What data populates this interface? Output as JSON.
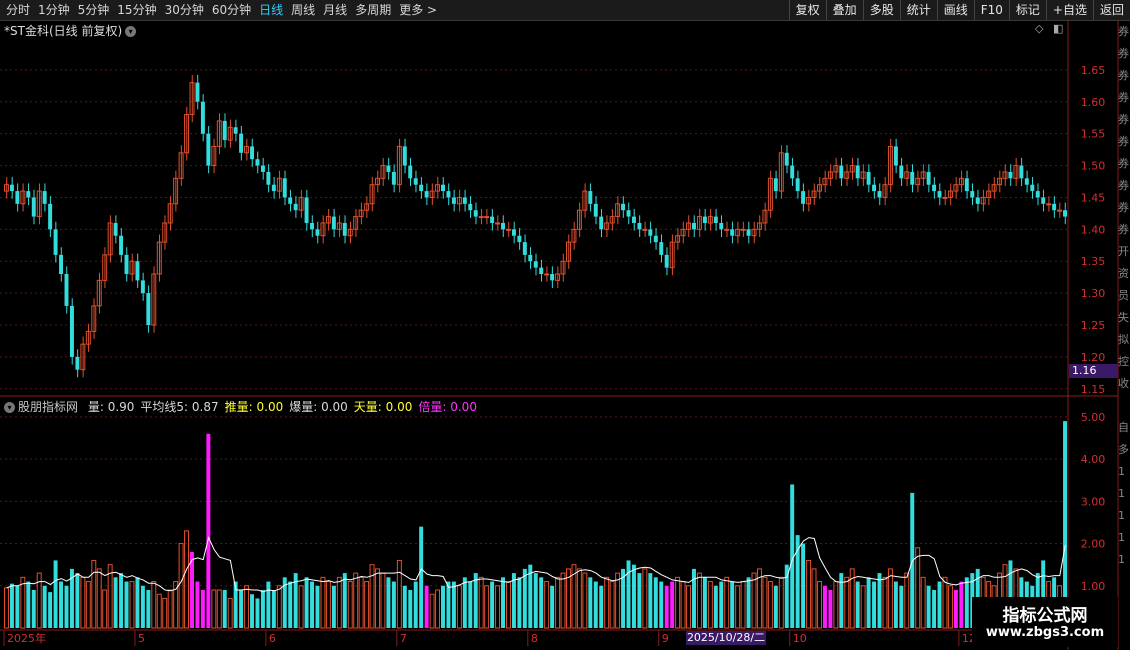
{
  "toolbar": {
    "periods": [
      {
        "label": "分时",
        "active": false
      },
      {
        "label": "1分钟",
        "active": false
      },
      {
        "label": "5分钟",
        "active": false
      },
      {
        "label": "15分钟",
        "active": false
      },
      {
        "label": "30分钟",
        "active": false
      },
      {
        "label": "60分钟",
        "active": false
      },
      {
        "label": "日线",
        "active": true
      },
      {
        "label": "周线",
        "active": false
      },
      {
        "label": "月线",
        "active": false
      },
      {
        "label": "多周期",
        "active": false
      },
      {
        "label": "更多 >",
        "active": false
      }
    ],
    "buttons": [
      "复权",
      "叠加",
      "多股",
      "统计",
      "画线",
      "F10",
      "标记",
      "+自选",
      "返回"
    ]
  },
  "main_title": "*ST金科(日线 前复权)",
  "main_title_icon": "chevron-down-icon",
  "corner_icons": [
    "diamond-icon",
    "panel-toggle-icon"
  ],
  "indicator": {
    "name": "股朋指标网",
    "fields": [
      {
        "label": "量:",
        "value": "0.90",
        "color": "#d8d8d8"
      },
      {
        "label": "平均线5:",
        "value": "0.87",
        "color": "#d8d8d8"
      },
      {
        "label": "推量:",
        "value": "0.00",
        "color": "#ffff33"
      },
      {
        "label": "爆量:",
        "value": "0.00",
        "color": "#d8d8d8"
      },
      {
        "label": "天量:",
        "value": "0.00",
        "color": "#ffff33"
      },
      {
        "label": "倍量:",
        "value": "0.00",
        "color": "#ff33ff"
      }
    ]
  },
  "current_price_tag": "1.16",
  "crosshair_date": "2025/10/28/二",
  "watermark": {
    "line1": "指标公式网",
    "line2": "www.zbgs3.com"
  },
  "right_strip_chars": [
    "券",
    "券",
    "券",
    "券",
    "券",
    "券",
    "券",
    "券",
    "券",
    "券",
    "开",
    "资",
    "员",
    "失",
    "拟",
    "控",
    "收",
    "",
    "自",
    "多",
    "1",
    "1",
    "1",
    "1",
    "1"
  ],
  "colors": {
    "up": "#e0502e",
    "down": "#33dddd",
    "special": "#ff1aff",
    "grid": "#5c1515",
    "axis_text": "#d03030",
    "ma_line": "#ffffff",
    "active_tab": "#33ccff"
  },
  "chart_data": [
    {
      "type": "candlestick",
      "title": "*ST金科(日线 前复权)",
      "y_axis_ticks": [
        "1.65",
        "1.60",
        "1.55",
        "1.50",
        "1.45",
        "1.40",
        "1.35",
        "1.30",
        "1.25",
        "1.20",
        "1.15"
      ],
      "ylim": [
        1.145,
        1.7
      ],
      "x_ticks": [
        "2025年",
        "5",
        "6",
        "7",
        "8",
        "9",
        "10",
        "12",
        "1"
      ],
      "x_tick_index": [
        0,
        24,
        48,
        72,
        96,
        120,
        144,
        175,
        200
      ],
      "close": [
        1.47,
        1.46,
        1.44,
        1.46,
        1.45,
        1.42,
        1.46,
        1.44,
        1.4,
        1.36,
        1.33,
        1.28,
        1.2,
        1.18,
        1.22,
        1.24,
        1.28,
        1.32,
        1.36,
        1.41,
        1.39,
        1.36,
        1.33,
        1.35,
        1.32,
        1.3,
        1.25,
        1.33,
        1.38,
        1.41,
        1.44,
        1.48,
        1.52,
        1.58,
        1.63,
        1.6,
        1.55,
        1.5,
        1.53,
        1.57,
        1.54,
        1.56,
        1.55,
        1.52,
        1.53,
        1.51,
        1.5,
        1.49,
        1.47,
        1.46,
        1.48,
        1.45,
        1.44,
        1.43,
        1.45,
        1.41,
        1.4,
        1.39,
        1.41,
        1.42,
        1.4,
        1.41,
        1.39,
        1.4,
        1.42,
        1.43,
        1.44,
        1.47,
        1.48,
        1.5,
        1.49,
        1.47,
        1.53,
        1.5,
        1.48,
        1.47,
        1.46,
        1.45,
        1.46,
        1.47,
        1.46,
        1.45,
        1.44,
        1.45,
        1.44,
        1.43,
        1.42,
        1.42,
        1.42,
        1.41,
        1.41,
        1.4,
        1.4,
        1.39,
        1.38,
        1.36,
        1.35,
        1.34,
        1.33,
        1.33,
        1.32,
        1.33,
        1.35,
        1.38,
        1.4,
        1.43,
        1.46,
        1.44,
        1.42,
        1.4,
        1.41,
        1.42,
        1.44,
        1.43,
        1.42,
        1.41,
        1.4,
        1.4,
        1.39,
        1.38,
        1.36,
        1.34,
        1.38,
        1.39,
        1.4,
        1.41,
        1.4,
        1.42,
        1.41,
        1.42,
        1.41,
        1.4,
        1.4,
        1.39,
        1.4,
        1.4,
        1.39,
        1.4,
        1.41,
        1.43,
        1.48,
        1.46,
        1.52,
        1.5,
        1.48,
        1.46,
        1.44,
        1.45,
        1.46,
        1.47,
        1.48,
        1.49,
        1.5,
        1.48,
        1.49,
        1.5,
        1.48,
        1.49,
        1.47,
        1.46,
        1.45,
        1.47,
        1.53,
        1.5,
        1.48,
        1.49,
        1.47,
        1.48,
        1.49,
        1.47,
        1.46,
        1.45,
        1.45,
        1.46,
        1.47,
        1.48,
        1.46,
        1.45,
        1.44,
        1.45,
        1.46,
        1.47,
        1.48,
        1.49,
        1.48,
        1.5,
        1.48,
        1.47,
        1.46,
        1.45,
        1.44,
        1.44,
        1.43,
        1.43,
        1.42
      ],
      "volume_y_ticks": [
        "5.00",
        "4.00",
        "3.00",
        "2.00",
        "1.00"
      ],
      "volume_ylim": [
        0,
        5.4
      ],
      "volume": [
        0.95,
        1.05,
        1.0,
        1.2,
        1.1,
        0.9,
        1.3,
        1.0,
        0.85,
        1.6,
        1.1,
        1.0,
        1.4,
        1.3,
        1.2,
        1.1,
        1.6,
        1.4,
        0.9,
        1.5,
        1.2,
        1.3,
        1.1,
        1.1,
        1.2,
        1.0,
        0.9,
        1.1,
        0.8,
        0.7,
        0.9,
        1.1,
        2.0,
        2.3,
        1.8,
        1.1,
        0.9,
        4.6,
        0.9,
        0.9,
        0.9,
        0.7,
        1.1,
        0.9,
        1.0,
        0.8,
        0.7,
        0.9,
        1.1,
        0.9,
        1.0,
        1.2,
        1.1,
        1.3,
        1.0,
        1.2,
        1.1,
        1.0,
        1.2,
        1.1,
        1.0,
        1.2,
        1.3,
        1.1,
        1.3,
        1.2,
        1.1,
        1.5,
        1.4,
        1.3,
        1.2,
        1.1,
        1.6,
        1.0,
        0.9,
        1.1,
        2.4,
        1.0,
        0.8,
        0.9,
        1.0,
        1.1,
        1.1,
        1.0,
        1.2,
        1.1,
        1.3,
        1.2,
        1.0,
        1.1,
        1.0,
        1.2,
        1.1,
        1.3,
        1.2,
        1.4,
        1.5,
        1.3,
        1.2,
        1.1,
        1.0,
        1.2,
        1.3,
        1.4,
        1.5,
        1.4,
        1.3,
        1.2,
        1.1,
        1.0,
        1.2,
        1.1,
        1.3,
        1.4,
        1.6,
        1.5,
        1.3,
        1.4,
        1.3,
        1.2,
        1.1,
        1.0,
        1.1,
        1.2,
        1.1,
        1.0,
        1.4,
        1.3,
        1.2,
        1.1,
        1.0,
        1.1,
        1.2,
        1.1,
        1.0,
        1.1,
        1.2,
        1.3,
        1.4,
        1.2,
        1.1,
        1.0,
        1.2,
        1.5,
        3.4,
        2.2,
        2.0,
        1.6,
        1.4,
        1.1,
        1.0,
        0.9,
        1.1,
        1.3,
        1.2,
        1.4,
        1.1,
        1.0,
        1.2,
        1.1,
        1.3,
        1.2,
        1.4,
        1.1,
        1.0,
        1.3,
        3.2,
        1.9,
        1.2,
        1.0,
        0.9,
        1.1,
        1.2,
        1.0,
        0.9,
        1.1,
        1.2,
        1.3,
        1.4,
        1.2,
        1.1,
        1.0,
        1.3,
        1.5,
        1.6,
        1.4,
        1.2,
        1.1,
        1.0,
        1.3,
        1.6,
        1.1,
        1.2,
        1.0,
        4.9,
        1.6,
        1.3,
        1.0,
        0.9,
        1.0,
        1.1,
        1.2
      ],
      "volume_special_index": [
        34,
        35,
        36,
        37,
        77,
        121,
        122,
        150,
        151,
        174,
        175,
        203
      ],
      "ma5_label": "平均线5"
    }
  ]
}
